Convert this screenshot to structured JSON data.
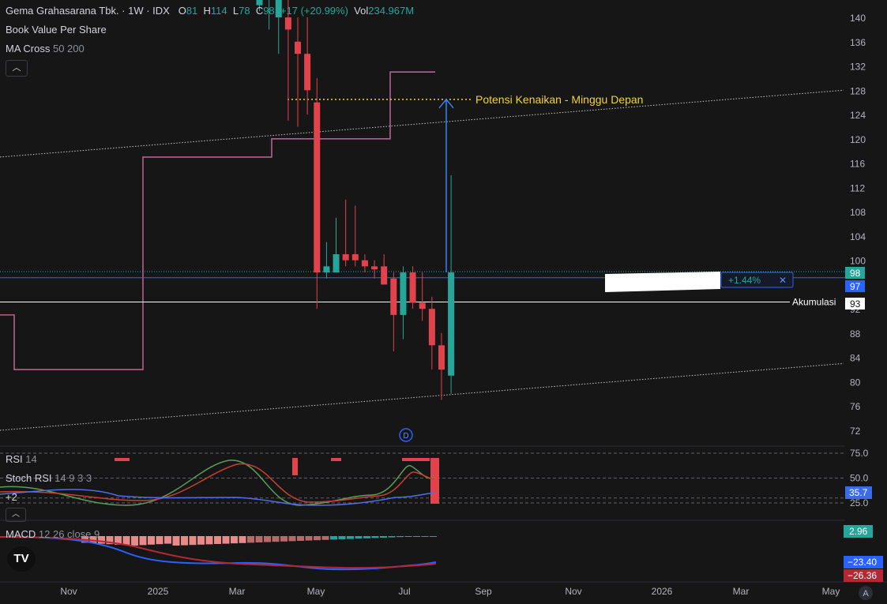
{
  "header": {
    "symbol": "Gema Grahasarana Tbk. · 1W · IDX",
    "open_label": "O",
    "open": "81",
    "high_label": "H",
    "high": "114",
    "low_label": "L",
    "low": "78",
    "close_label": "C",
    "close": "98",
    "change": "+17 (+20.99%)",
    "vol_label": "Vol",
    "vol": "234.967M"
  },
  "indicators": {
    "bvps": "Book Value Per Share",
    "ma_cross": "MA Cross",
    "ma_cross_params": "50 200",
    "rsi": "RSI",
    "rsi_params": "14",
    "stoch": "Stoch RSI",
    "stoch_params": "14 9 3 3",
    "more": "+2",
    "macd": "MACD",
    "macd_params": "12 26 close 9"
  },
  "annotations": {
    "target_text": "Potensi Kenaikan - Minggu Depan",
    "akumulasi": "Akumulasi",
    "measure_pct": "+1.44%",
    "measure_close": "✕",
    "dividend_marker": "D"
  },
  "price_badges": {
    "last": "98",
    "crosshair": "97",
    "akumulasi": "93"
  },
  "osc_badges": {
    "stoch": "35.7",
    "macd_hist": "2.96",
    "macd_line": "−23.40",
    "signal_line": "−26.36"
  },
  "axis_mode": "A",
  "logo": "TV",
  "chart_data": {
    "type": "candlestick",
    "price_axis": {
      "min": 72,
      "max": 140,
      "ticks": [
        140,
        136,
        132,
        128,
        124,
        120,
        116,
        112,
        108,
        104,
        100,
        96,
        92,
        88,
        84,
        80,
        76,
        72
      ]
    },
    "time_axis": {
      "labels": [
        "Nov",
        "2025",
        "Mar",
        "May",
        "Jul",
        "Sep",
        "Nov",
        "2026",
        "Mar",
        "May"
      ]
    },
    "osc_axis": {
      "ticks": [
        "75.0",
        "50.0",
        "25.0"
      ]
    },
    "candles": [
      {
        "o": 142,
        "h": 150,
        "l": 141,
        "c": 146
      },
      {
        "o": 143,
        "h": 148,
        "l": 138,
        "c": 145
      },
      {
        "o": 140,
        "h": 146,
        "l": 134,
        "c": 143
      },
      {
        "o": 140,
        "h": 143,
        "l": 123,
        "c": 138
      },
      {
        "o": 136,
        "h": 140,
        "l": 122,
        "c": 134
      },
      {
        "o": 134,
        "h": 140,
        "l": 124,
        "c": 128
      },
      {
        "o": 126,
        "h": 130,
        "l": 92,
        "c": 98
      },
      {
        "o": 98,
        "h": 103,
        "l": 97,
        "c": 99
      },
      {
        "o": 98,
        "h": 107,
        "l": 98,
        "c": 101
      },
      {
        "o": 101,
        "h": 110,
        "l": 99,
        "c": 100
      },
      {
        "o": 101,
        "h": 109,
        "l": 99,
        "c": 100
      },
      {
        "o": 100,
        "h": 101,
        "l": 98,
        "c": 99
      },
      {
        "o": 99,
        "h": 100,
        "l": 97,
        "c": 98.5
      },
      {
        "o": 99,
        "h": 101,
        "l": 96,
        "c": 96
      },
      {
        "o": 97,
        "h": 98,
        "l": 85,
        "c": 91
      },
      {
        "o": 91,
        "h": 99,
        "l": 87,
        "c": 98
      },
      {
        "o": 98,
        "h": 99,
        "l": 92,
        "c": 93
      },
      {
        "o": 93,
        "h": 98,
        "l": 90,
        "c": 92
      },
      {
        "o": 92,
        "h": 94,
        "l": 82,
        "c": 86
      },
      {
        "o": 86,
        "h": 88,
        "l": 77,
        "c": 82
      },
      {
        "o": 81,
        "h": 114,
        "l": 78,
        "c": 98
      }
    ],
    "bvps_steps": [
      {
        "x": "Sep",
        "value": 91
      },
      {
        "x": "Sep",
        "value": 82
      },
      {
        "x": "2025",
        "value": 82
      },
      {
        "x": "2025",
        "value": 117
      },
      {
        "x": "Mar",
        "value": 117
      },
      {
        "x": "Mar",
        "value": 120
      },
      {
        "x": "Jun",
        "value": 120
      },
      {
        "x": "Jun",
        "value": 131
      },
      {
        "x": "Aug",
        "value": 131
      }
    ],
    "trendline_upper": {
      "from": 117,
      "to": 128
    },
    "trendline_lower": {
      "from": 72,
      "to": 83
    },
    "target_level": 126.5,
    "akumulasi_level": 93,
    "crosshair_level": 97,
    "last_price": 98,
    "arrow_from": 98,
    "arrow_to": 126.5
  }
}
